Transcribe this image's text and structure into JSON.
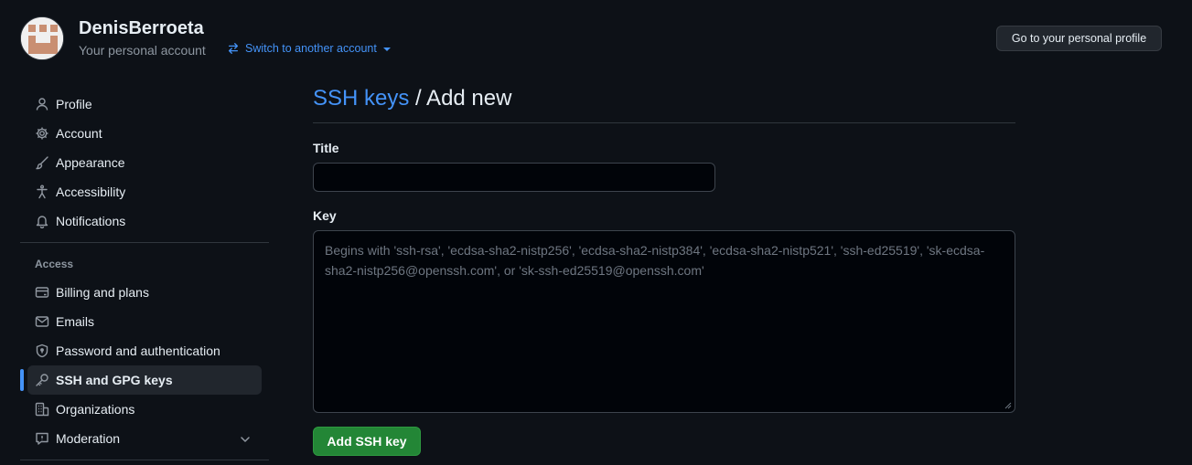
{
  "header": {
    "username": "DenisBerroeta",
    "subtitle": "Your personal account",
    "switch_label": "Switch to another account",
    "profile_button": "Go to your personal profile"
  },
  "sidebar": {
    "items": [
      {
        "label": "Profile",
        "icon": "person-icon"
      },
      {
        "label": "Account",
        "icon": "gear-icon"
      },
      {
        "label": "Appearance",
        "icon": "paintbrush-icon"
      },
      {
        "label": "Accessibility",
        "icon": "accessibility-icon"
      },
      {
        "label": "Notifications",
        "icon": "bell-icon"
      }
    ],
    "access_label": "Access",
    "access_items": [
      {
        "label": "Billing and plans",
        "icon": "credit-card-icon"
      },
      {
        "label": "Emails",
        "icon": "mail-icon"
      },
      {
        "label": "Password and authentication",
        "icon": "shield-lock-icon"
      },
      {
        "label": "SSH and GPG keys",
        "icon": "key-icon",
        "active": true
      },
      {
        "label": "Organizations",
        "icon": "organization-icon"
      },
      {
        "label": "Moderation",
        "icon": "report-icon"
      }
    ]
  },
  "main": {
    "breadcrumb_link": "SSH keys",
    "breadcrumb_current": "/ Add new",
    "title_label": "Title",
    "title_value": "",
    "key_label": "Key",
    "key_placeholder": "Begins with 'ssh-rsa', 'ecdsa-sha2-nistp256', 'ecdsa-sha2-nistp384', 'ecdsa-sha2-nistp521', 'ssh-ed25519', 'sk-ecdsa-sha2-nistp256@openssh.com', or 'sk-ssh-ed25519@openssh.com'",
    "submit_label": "Add SSH key"
  },
  "colors": {
    "background": "#0d1117",
    "accent": "#4493f8",
    "primary_button": "#238636"
  }
}
